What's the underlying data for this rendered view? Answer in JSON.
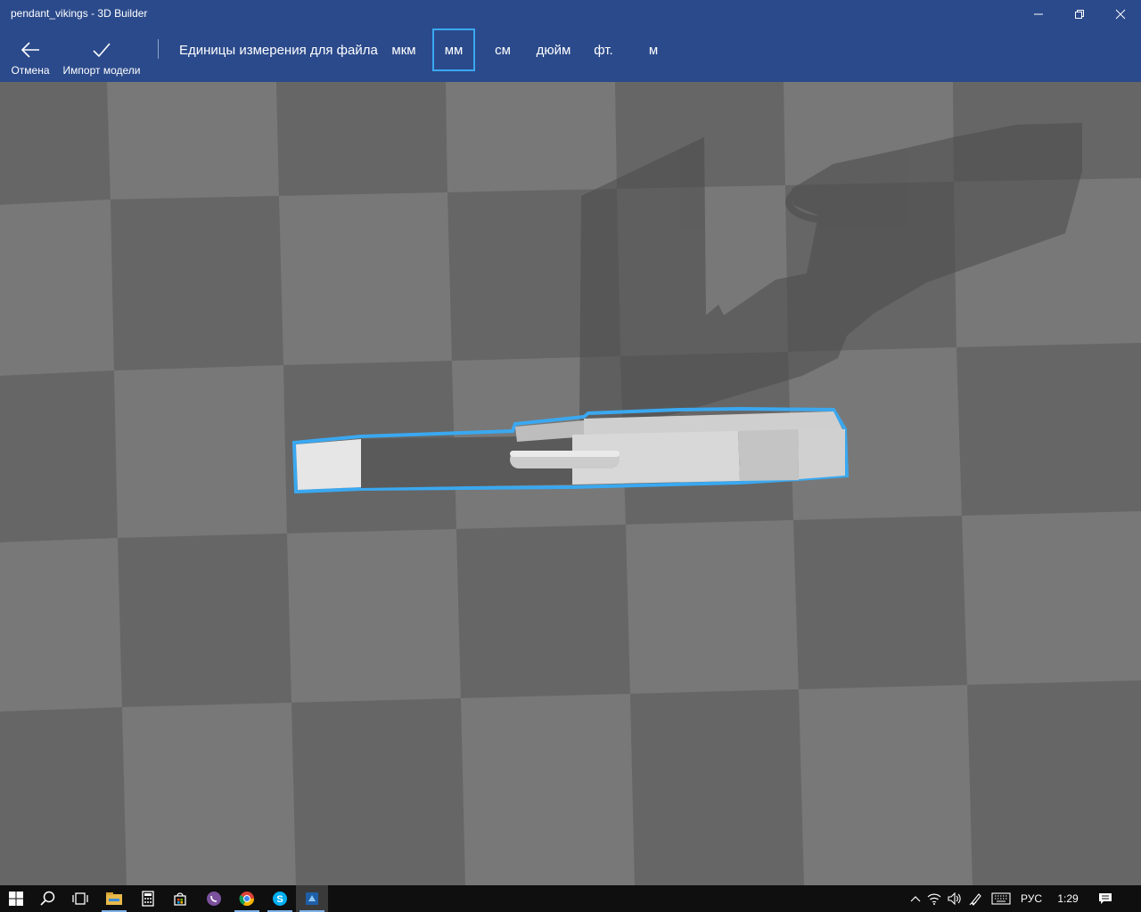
{
  "window": {
    "title": "pendant_vikings - 3D Builder",
    "controls": [
      "minimize-icon",
      "restore-icon",
      "close-icon"
    ]
  },
  "toolbar": {
    "cancel_label": "Отмена",
    "import_label": "Импорт модели",
    "units_label": "Единицы измерения для файла",
    "units": [
      "мкм",
      "мм",
      "см",
      "дюйм",
      "фт.",
      "м"
    ],
    "selected_unit": "мм"
  },
  "colors": {
    "chrome": "#2b4a8b",
    "selection": "#3aa8f0",
    "floor_light": "#767676",
    "floor_dark": "#666666",
    "taskbar": "#0f0f0f"
  },
  "taskbar": {
    "apps": [
      "windows-start-icon",
      "search-icon",
      "task-view-icon",
      "file-explorer-icon",
      "calculator-icon",
      "store-icon",
      "viber-icon",
      "chrome-icon",
      "skype-icon",
      "3d-builder-icon"
    ],
    "language": "РУС",
    "time": "1:29"
  }
}
